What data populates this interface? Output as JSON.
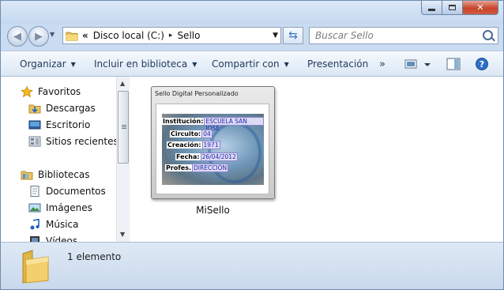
{
  "address_bar": {
    "recent_chevron": "«",
    "crumbs": [
      "Disco local (C:)",
      "Sello"
    ],
    "separator": "▸"
  },
  "search": {
    "placeholder": "Buscar Sello"
  },
  "toolbar": {
    "organize": "Organizar",
    "include_in_library": "Incluir en biblioteca",
    "share_with": "Compartir con",
    "presentation": "Presentación",
    "more": "»"
  },
  "navigation": {
    "favorites": {
      "label": "Favoritos",
      "items": [
        "Descargas",
        "Escritorio",
        "Sitios recientes"
      ]
    },
    "libraries": {
      "label": "Bibliotecas",
      "items": [
        "Documentos",
        "Imágenes",
        "Música",
        "Vídeos"
      ]
    }
  },
  "file": {
    "name": "MiSello",
    "thumbnail_title": "Sello Digital Personalizado",
    "fields": [
      {
        "label": "Institución:",
        "value": "ESCUELA SAN JOSE"
      },
      {
        "label": "Circuito:",
        "value": "04"
      },
      {
        "label": "Creación:",
        "value": "1971"
      },
      {
        "label": "Fecha:",
        "value": "26/04/2012"
      },
      {
        "label": "Profes.",
        "value": "DIRECCIÓN"
      }
    ]
  },
  "status": {
    "text": "1 elemento"
  },
  "colors": {
    "window_frame": "#c9dcf2",
    "close_button": "#c6452b",
    "toolbar_text": "#1e395b",
    "accent_blue": "#3773c2"
  }
}
